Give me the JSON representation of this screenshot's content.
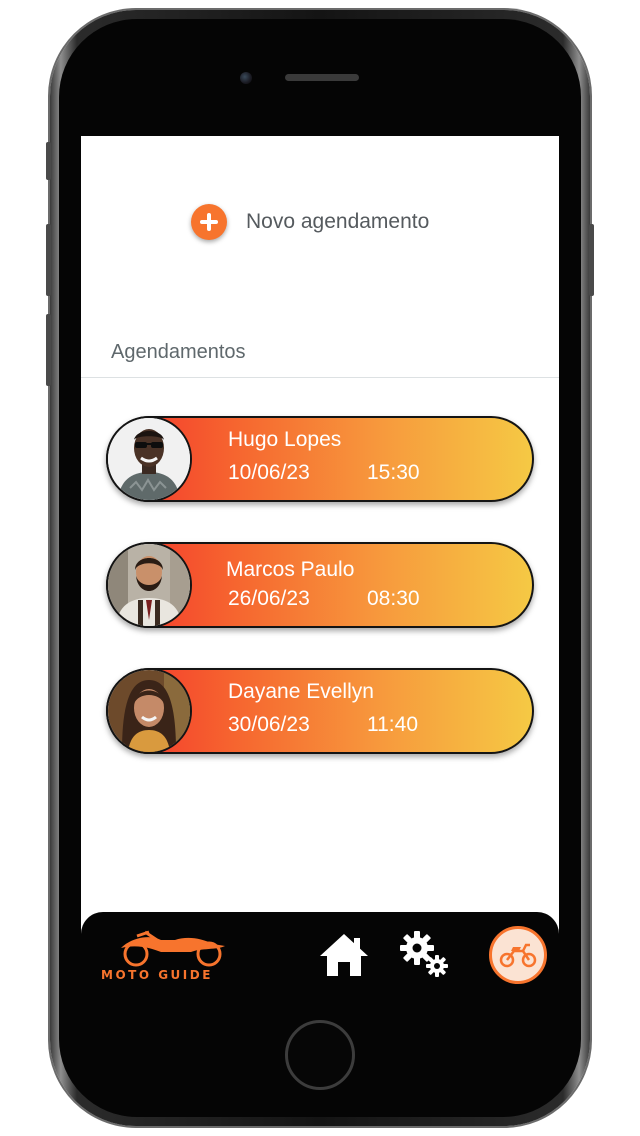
{
  "new_appointment": {
    "label": "Novo agendamento",
    "icon": "plus-circle-icon"
  },
  "section": {
    "title": "Agendamentos"
  },
  "appointments": [
    {
      "name": "Hugo Lopes",
      "date": "10/06/23",
      "time": "15:30"
    },
    {
      "name": "Marcos Paulo",
      "date": "26/06/23",
      "time": "08:30"
    },
    {
      "name": "Dayane Evellyn",
      "date": "30/06/23",
      "time": "11:40"
    }
  ],
  "nav": {
    "logo_text": "MOTO GUIDE",
    "items": [
      "home-icon",
      "settings-gears-icon",
      "motorcycle-icon"
    ]
  },
  "colors": {
    "accent": "#f7742d",
    "card_gradient_start": "#f3322c",
    "card_gradient_end": "#f5c944",
    "nav_background": "#050505"
  }
}
